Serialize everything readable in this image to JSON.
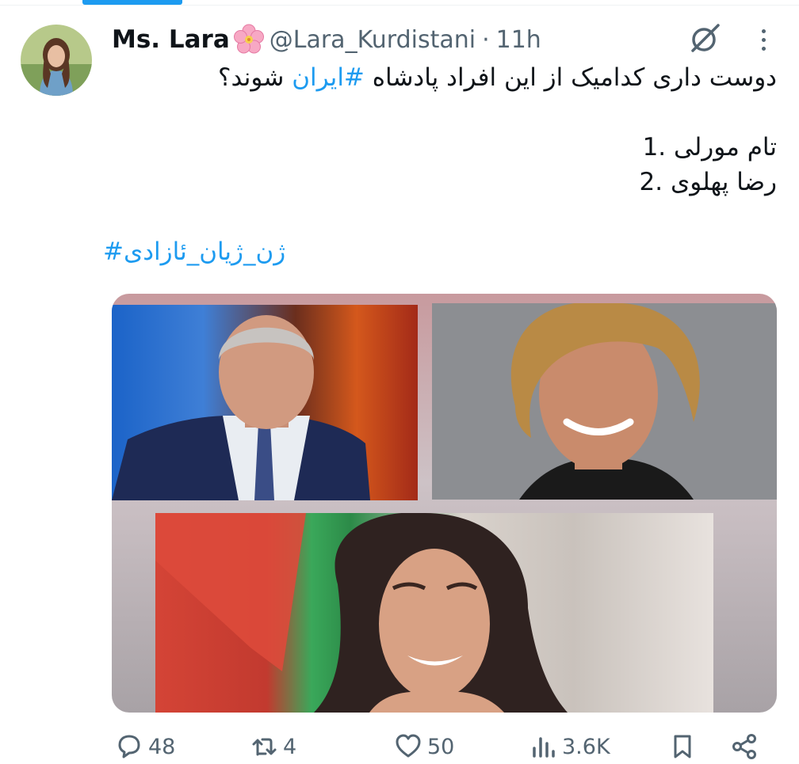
{
  "tweet": {
    "author_name": "Ms. Lara",
    "author_handle": "@Lara_Kurdistani",
    "separator": "·",
    "time": "11h",
    "line1_before": "دوست داری کدامیک از این افراد پادشاه ",
    "line1_hashtag": "#ایران",
    "line1_after": " شوند؟",
    "option1": "1. تام مورلی",
    "option2": "2. رضا پهلوی",
    "hashtag_line": "ژن_ژیان_ئازادی#"
  },
  "actions": {
    "replies": "48",
    "reposts": "4",
    "likes": "50",
    "views": "3.6K"
  },
  "icons": {
    "author_badge": "cherry-blossom-icon",
    "grok": "grok-icon",
    "more": "more-dots-icon",
    "reply": "reply-icon",
    "repost": "repost-icon",
    "like": "heart-icon",
    "views": "views-icon",
    "bookmark": "bookmark-icon",
    "share": "share-icon"
  },
  "colors": {
    "link": "#1d9bf0",
    "secondary_text": "#536471",
    "primary_text": "#0f1419"
  }
}
